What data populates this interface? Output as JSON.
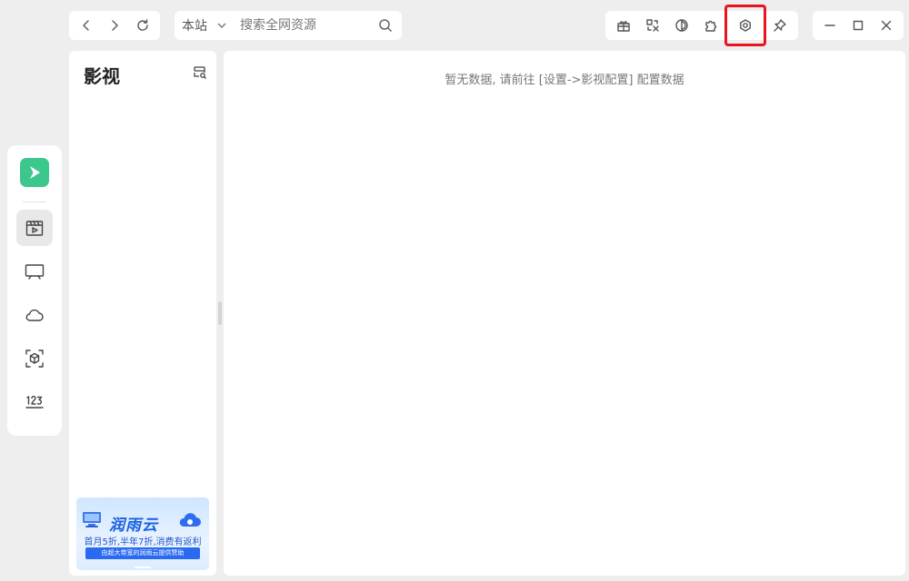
{
  "nav": {
    "back_icon": "chevron-left-icon",
    "forward_icon": "chevron-right-icon",
    "refresh_icon": "refresh-icon"
  },
  "search": {
    "scope_label": "本站",
    "placeholder": "搜索全网资源",
    "value": ""
  },
  "toolbar": {
    "icons": [
      "gift-icon",
      "translate-icon",
      "theme-contrast-icon",
      "puzzle-plugin-icon",
      "settings-hexagon-icon",
      "pin-icon"
    ],
    "highlighted": "settings-hexagon-icon",
    "highlight_color": "#e8141e"
  },
  "window": {
    "icons": [
      "minimize-icon",
      "maximize-icon",
      "close-icon"
    ]
  },
  "rail": {
    "logo_color": "#3cc78d",
    "items": [
      "film-icon",
      "tv-icon",
      "cloud-icon",
      "scan-cube-icon",
      "number-123-icon"
    ],
    "active": "film-icon"
  },
  "category": {
    "title": "影视",
    "filter_icon": "server-search-icon"
  },
  "ad": {
    "brand": "润雨云",
    "line1": "首月5折,半年7折,消费有返利",
    "line2": "由超大带宽的润雨云提供赞助"
  },
  "content": {
    "empty_message": "暂无数据, 请前往 [设置->影视配置] 配置数据"
  }
}
